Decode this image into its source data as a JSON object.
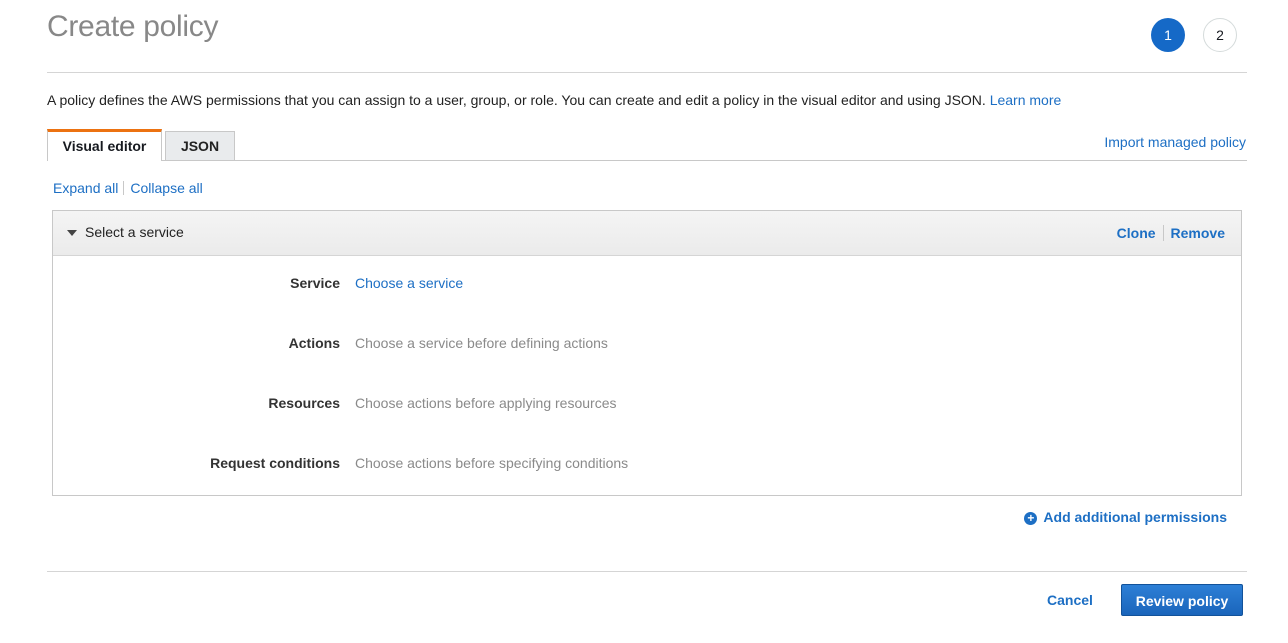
{
  "header": {
    "title": "Create policy",
    "steps": [
      {
        "label": "1",
        "state": "active"
      },
      {
        "label": "2",
        "state": "inactive"
      }
    ]
  },
  "description": {
    "text": "A policy defines the AWS permissions that you can assign to a user, group, or role. You can create and edit a policy in the visual editor and using JSON.",
    "learn_more": "Learn more"
  },
  "tabs": [
    {
      "label": "Visual editor",
      "active": true
    },
    {
      "label": "JSON",
      "active": false
    }
  ],
  "import_managed_policy": "Import managed policy",
  "expand_all": "Expand all",
  "collapse_all": "Collapse all",
  "permission_block": {
    "title": "Select a service",
    "clone": "Clone",
    "remove": "Remove",
    "rows": [
      {
        "label": "Service",
        "value": "Choose a service",
        "is_link": true
      },
      {
        "label": "Actions",
        "value": "Choose a service before defining actions",
        "is_link": false
      },
      {
        "label": "Resources",
        "value": "Choose actions before applying resources",
        "is_link": false
      },
      {
        "label": "Request conditions",
        "value": "Choose actions before specifying conditions",
        "is_link": false
      }
    ]
  },
  "add_additional_permissions": "Add additional permissions",
  "footer": {
    "cancel": "Cancel",
    "review_policy": "Review policy"
  },
  "colors": {
    "accent_orange": "#ec7211",
    "link_blue": "#1d6fc4",
    "primary_button": "#1a65bb",
    "step_active": "#1569c7"
  },
  "icons": {
    "caret": "caret-down-icon",
    "add": "plus-circle-icon"
  }
}
